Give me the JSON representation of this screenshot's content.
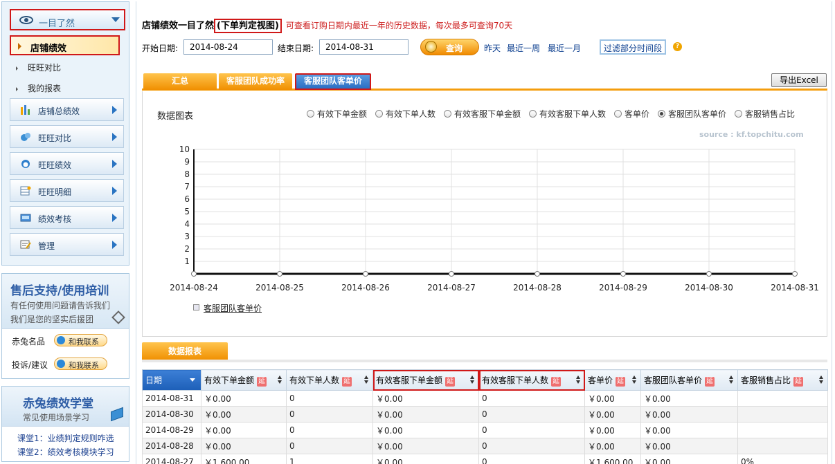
{
  "sidebar": {
    "brand_label": "一目了然",
    "active_sub": "店铺绩效",
    "sub_items": [
      "旺旺对比",
      "我的报表"
    ],
    "menu": [
      {
        "label": "店铺总绩效",
        "icon": "bar-chart-icon"
      },
      {
        "label": "旺旺对比",
        "icon": "wangwang-compare-icon"
      },
      {
        "label": "旺旺绩效",
        "icon": "wangwang-icon"
      },
      {
        "label": "旺旺明细",
        "icon": "detail-table-icon"
      },
      {
        "label": "绩效考核",
        "icon": "assessment-icon"
      },
      {
        "label": "管理",
        "icon": "manage-icon"
      }
    ],
    "support": {
      "title": "售后支持/使用培训",
      "line1": "有任何使用问题请告诉我们",
      "line2": "我们是您的坚实后援团",
      "contacts": [
        {
          "label": "赤兔名品",
          "button": "和我联系"
        },
        {
          "label": "投诉/建议",
          "button": "和我联系"
        }
      ]
    },
    "academy": {
      "title": "赤兔绩效学堂",
      "subtitle": "常见使用场景学习",
      "lessons": [
        "课堂1：业绩判定规则咋选",
        "课堂2：绩效考核模块学习"
      ]
    }
  },
  "main": {
    "title": "店铺绩效一目了然",
    "title_tag": "(下单判定视图)",
    "note": "可查看订购日期内最近一年的历史数据，每次最多可查询70天",
    "start_label": "开始日期:",
    "start_date": "2014-08-24",
    "end_label": "结束日期:",
    "end_date": "2014-08-31",
    "query_label": "查询",
    "quick_links": [
      "昨天",
      "最近一周",
      "最近一月"
    ],
    "filter_label": "过滤部分时间段",
    "tabs": [
      "汇总",
      "客服团队成功率",
      "客服团队客单价"
    ],
    "export_label": "导出Excel",
    "chart_panel_title": "数据图表",
    "radio_options": [
      "有效下单金额",
      "有效下单人数",
      "有效客服下单金额",
      "有效客服下单人数",
      "客单价",
      "客服团队客单价",
      "客服销售占比"
    ],
    "selected_option": 5,
    "source": "source : kf.topchitu.com",
    "report_tab": "数据报表"
  },
  "chart_data": {
    "type": "line",
    "x": [
      "2014-08-24",
      "2014-08-25",
      "2014-08-26",
      "2014-08-27",
      "2014-08-28",
      "2014-08-29",
      "2014-08-30",
      "2014-08-31"
    ],
    "series": [
      {
        "name": "客服团队客单价",
        "values": [
          0,
          0,
          0,
          0,
          0,
          0,
          0,
          0
        ]
      }
    ],
    "ylim": [
      0,
      10
    ],
    "yticks": [
      1,
      2,
      3,
      4,
      5,
      6,
      7,
      8,
      9,
      10
    ],
    "grid": true,
    "line_color": "#111111"
  },
  "table": {
    "columns": [
      "日期",
      "有效下单金额",
      "有效下单人数",
      "有效客服下单金额",
      "有效客服下单人数",
      "客单价",
      "客服团队客单价",
      "客服销售占比"
    ],
    "extended_columns": [
      1,
      2,
      3,
      4,
      5,
      6,
      7
    ],
    "ext_badge": "延",
    "rows": [
      [
        "2014-08-31",
        "￥0.00",
        "0",
        "￥0.00",
        "0",
        "￥0.00",
        "￥0.00",
        ""
      ],
      [
        "2014-08-30",
        "￥0.00",
        "0",
        "￥0.00",
        "0",
        "￥0.00",
        "￥0.00",
        ""
      ],
      [
        "2014-08-29",
        "￥0.00",
        "0",
        "￥0.00",
        "0",
        "￥0.00",
        "￥0.00",
        ""
      ],
      [
        "2014-08-28",
        "￥0.00",
        "0",
        "￥0.00",
        "0",
        "￥0.00",
        "￥0.00",
        ""
      ],
      [
        "2014-08-27",
        "￥1,600.00",
        "1",
        "￥0.00",
        "0",
        "￥1,600.00",
        "￥0.00",
        "0%"
      ]
    ]
  }
}
